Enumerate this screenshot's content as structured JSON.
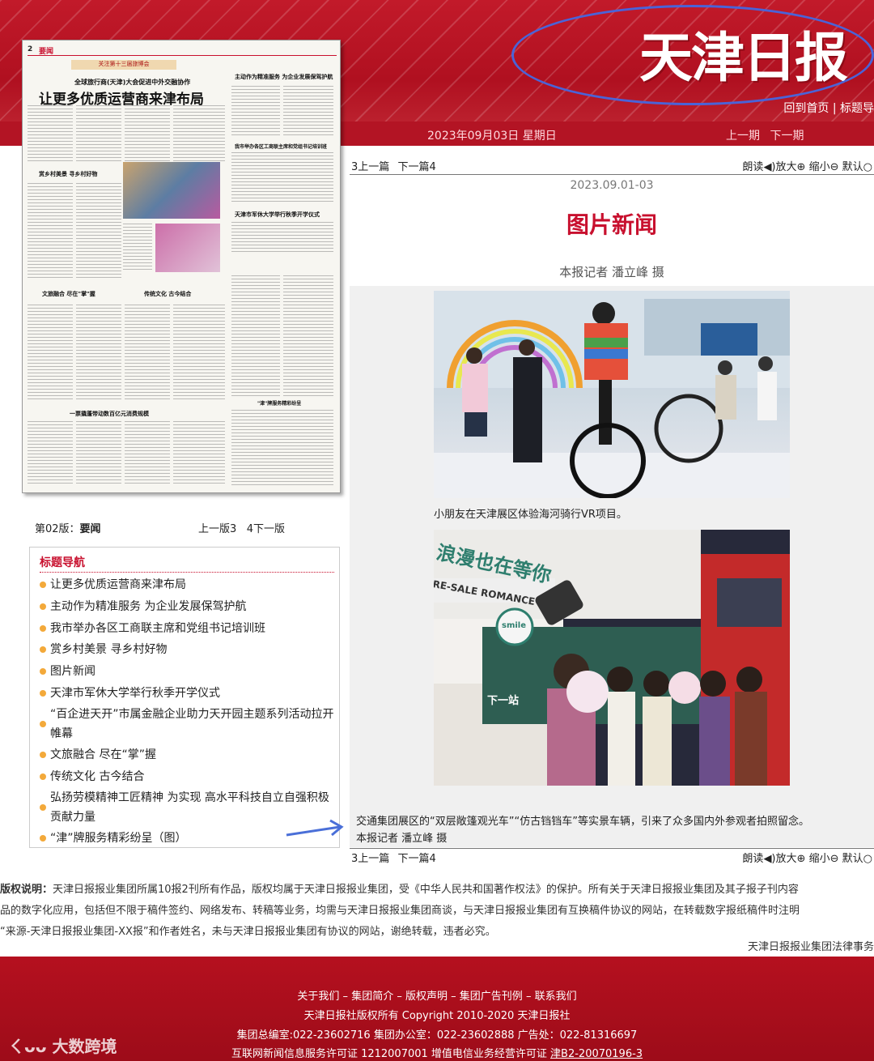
{
  "header": {
    "masthead": "天津日报",
    "top_links": [
      "回到首页",
      "标题导"
    ],
    "date": "2023年09月03日 星期日",
    "page_prev": "上一期",
    "page_next": "下一期"
  },
  "newspaper_thumb": {
    "page_no": "2",
    "section": "要闻",
    "banner": "关注第十三届旅博会",
    "headline_top": "全球旅行商(天津)大会促进中外交融协作",
    "headline_main": "让更多优质运营商来津布局",
    "side_head1": "主动作为精准服务 为企业发展保驾护航",
    "side_head2": "我市举办各区工商联主席和党组书记培训班",
    "side_head3": "天津市军休大学举行秋季开学仪式",
    "head_village": "赏乡村美景 寻乡村好物",
    "head_culture": "文旅融合 尽在\"掌\"握",
    "head_trad": "传统文化 古今结合",
    "head_consume": "一票撬蓬带动数百亿元消费规模",
    "head_brand": "\"津\"牌服务精彩纷呈"
  },
  "edition": {
    "label": "第02版：",
    "name": "要闻",
    "prev": "上一版3",
    "next": "4下一版"
  },
  "title_nav": {
    "heading": "标题导航",
    "items": [
      "让更多优质运营商来津布局",
      "主动作为精准服务 为企业发展保驾护航",
      "我市举办各区工商联主席和党组书记培训班",
      "赏乡村美景 寻乡村好物",
      "图片新闻",
      "天津市军休大学举行秋季开学仪式",
      "“百企进天开”市属金融企业助力天开园主题系列活动拉开帷幕",
      "文旅融合 尽在“掌”握",
      "传统文化 古今结合",
      "弘扬劳模精神工匠精神 为实现 高水平科技自立自强积极贡献力量",
      "“津”牌服务精彩纷呈（图）"
    ]
  },
  "article": {
    "nav_prev_num": "3",
    "nav_prev": "上一篇",
    "nav_next": "下一篇",
    "nav_next_num": "4",
    "tools": {
      "read": "朗读",
      "zoom_in": "放大",
      "zoom_out": "缩小",
      "default": "默认"
    },
    "date": "2023.09.01-03",
    "title": "图片新闻",
    "byline": "本报记者 潘立峰 摄",
    "caption1": "小朋友在天津展区体验海河骑行VR项目。",
    "photo2_sign": "浪漫也在等你",
    "photo2_sign2": "RE-SALE ROMANCE",
    "photo2_smile": "smile",
    "photo2_stop": "下一站",
    "caption2": "交通集团展区的“双层敞篷观光车”“仿古铛铛车”等实景车辆，引来了众多国内外参观者拍照留念。",
    "caption3": "本报记者 潘立峰 摄"
  },
  "copyright": {
    "label": "版权说明：",
    "line1": "天津日报报业集团所属10报2刊所有作品，版权均属于天津日报报业集团，受《中华人民共和国著作权法》的保护。所有关于天津日报报业集团及其子报子刊内容",
    "line2": "品的数字化应用，包括但不限于稿件签约、网络发布、转稿等业务，均需与天津日报报业集团商谈，与天津日报报业集团有互换稿件协议的网站，在转载数字报纸稿件时注明",
    "line3": "“来源-天津日报报业集团-XX报”和作者姓名，未与天津日报报业集团有协议的网站，谢绝转载，违者必究。",
    "legal": "天津日报报业集团法律事务"
  },
  "footer": {
    "links": [
      "关于我们",
      "集团简介",
      "版权声明",
      "集团广告刊例",
      "联系我们"
    ],
    "sep": "–",
    "line2": "天津日报社版权所有 Copyright 2010-2020 天津日报社",
    "line3": "集团总编室:022-23602716 集团办公室：022-23602888 广告处：022-81316697",
    "line4_prefix": "互联网新闻信息服务许可证 1212007001 增值电信业务经营许可证 ",
    "line4_link": "津B2-20070196-3",
    "watermark": "大数跨境"
  },
  "colors": {
    "brand_red": "#c8102e",
    "ellipse_blue": "#4a63d8",
    "bullet_orange": "#f3a93a"
  }
}
